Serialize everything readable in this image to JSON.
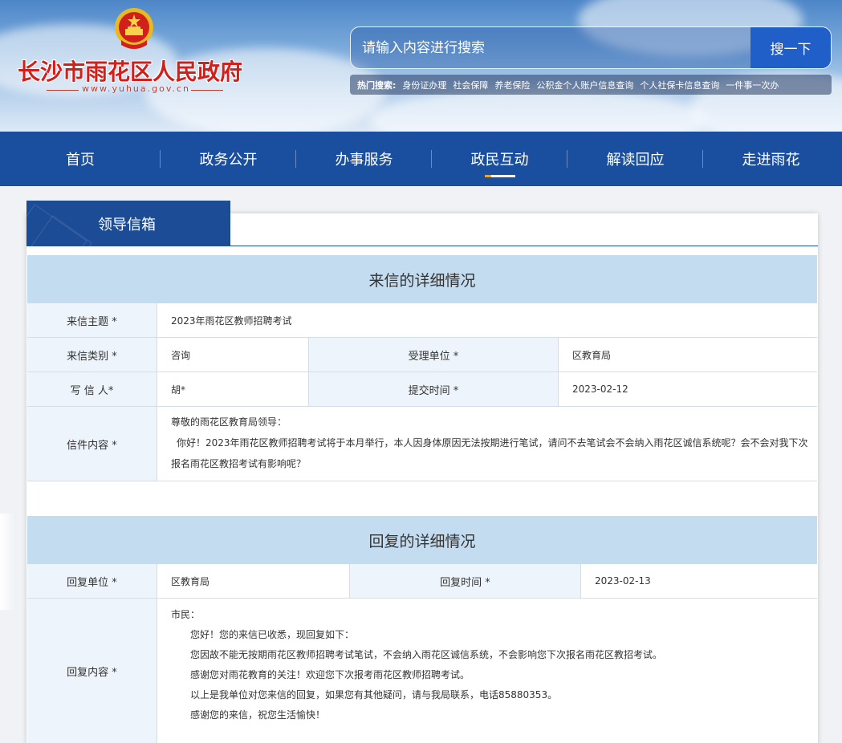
{
  "header": {
    "site_title": "长沙市雨花区人民政府",
    "site_url": "www.yuhua.gov.cn",
    "search": {
      "placeholder": "请输入内容进行搜索",
      "button_label": "搜一下"
    },
    "hot_search": {
      "label": "热门搜索:",
      "links": [
        "身份证办理",
        "社会保障",
        "养老保险",
        "公积金个人账户信息查询",
        "个人社保卡信息查询",
        "一件事一次办"
      ]
    }
  },
  "nav": {
    "items": [
      "首页",
      "政务公开",
      "办事服务",
      "政民互动",
      "解读回应",
      "走进雨花"
    ],
    "active": "政民互动"
  },
  "panel": {
    "tab_title": "领导信箱",
    "letter": {
      "section_title": "来信的详细情况",
      "subject_label": "来信主题 *",
      "subject_value": "2023年雨花区教师招聘考试",
      "category_label": "来信类别 *",
      "category_value": "咨询",
      "unit_label": "受理单位 *",
      "unit_value": "区教育局",
      "writer_label": "写 信 人*",
      "writer_value": "胡*",
      "submit_time_label": "提交时间 *",
      "submit_time_value": "2023-02-12",
      "content_label": "信件内容 *",
      "content_lines": [
        "尊敬的雨花区教育局领导：",
        "你好！2023年雨花区教师招聘考试将于本月举行，本人因身体原因无法按期进行笔试，请问不去笔试会不会纳入雨花区诚信系统呢？会不会对我下次",
        "报名雨花区教招考试有影响呢？"
      ]
    },
    "reply": {
      "section_title": "回复的详细情况",
      "unit_label": "回复单位 *",
      "unit_value": "区教育局",
      "time_label": "回复时间 *",
      "time_value": "2023-02-13",
      "content_label": "回复内容 *",
      "content_lines": [
        "市民：",
        "您好！您的来信已收悉，现回复如下：",
        "您因故不能无按期雨花区教师招聘考试笔试，不会纳入雨花区诚信系统，不会影响您下次报名雨花区教招考试。",
        "感谢您对雨花教育的关注！欢迎您下次报考雨花区教师招聘考试。",
        "以上是我单位对您来信的回复，如果您有其他疑问，请与我局联系，电话85880353。",
        "感谢您的来信，祝您生活愉快！"
      ]
    }
  },
  "colors": {
    "nav_bg": "#1a4fa0",
    "title_red": "#d1201c",
    "section_bg": "#c3dcef",
    "label_bg": "#eef4fb",
    "tab_bg": "#1d4c96"
  }
}
